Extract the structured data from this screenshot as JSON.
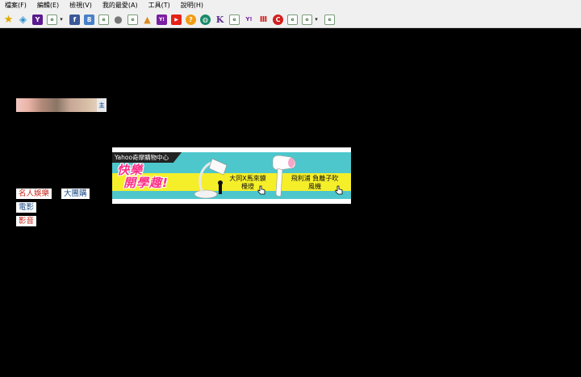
{
  "menu": {
    "items": [
      {
        "label": "檔案(F)"
      },
      {
        "label": "編輯(E)"
      },
      {
        "label": "檢視(V)"
      },
      {
        "label": "我的最愛(A)"
      },
      {
        "label": "工具(T)"
      },
      {
        "label": "說明(H)"
      }
    ]
  },
  "toolbar": {
    "icons": [
      "favorites-star-icon",
      "add-favorite-icon",
      "yahoo-y-icon",
      "page-icon",
      "facebook-icon",
      "google-icon",
      "page-icon",
      "apple-icon",
      "page-icon",
      "bookmark-icon",
      "yahoo-icon",
      "youtube-icon",
      "search-icon",
      "globe-icon",
      "k-icon",
      "page-icon",
      "yahoo-icon",
      "news-icon",
      "red-c-icon",
      "page-icon",
      "page-icon",
      "page-icon"
    ],
    "labels": {
      "yahoo_y": "Y",
      "facebook": "f",
      "google": "8",
      "youtube": "▶",
      "k": "K",
      "yahoo_sm": "Y!",
      "m": "m",
      "c": "C",
      "yo": "Y!",
      "dd": "▾"
    }
  },
  "photo": {
    "tag": "主"
  },
  "banner": {
    "tag": "Yahoo奇摩購物中心",
    "slogan_1": "快樂",
    "slogan_2": "開學趣!",
    "product_1": {
      "line1": "大同X馬來貘",
      "line2": "檯燈"
    },
    "product_2": {
      "line1": "飛利浦",
      "line2": "負離子吹風機"
    }
  },
  "links": [
    {
      "label": "名人娛樂"
    },
    {
      "label": "大團購"
    },
    {
      "label": "電影"
    },
    {
      "label": "影音"
    }
  ]
}
